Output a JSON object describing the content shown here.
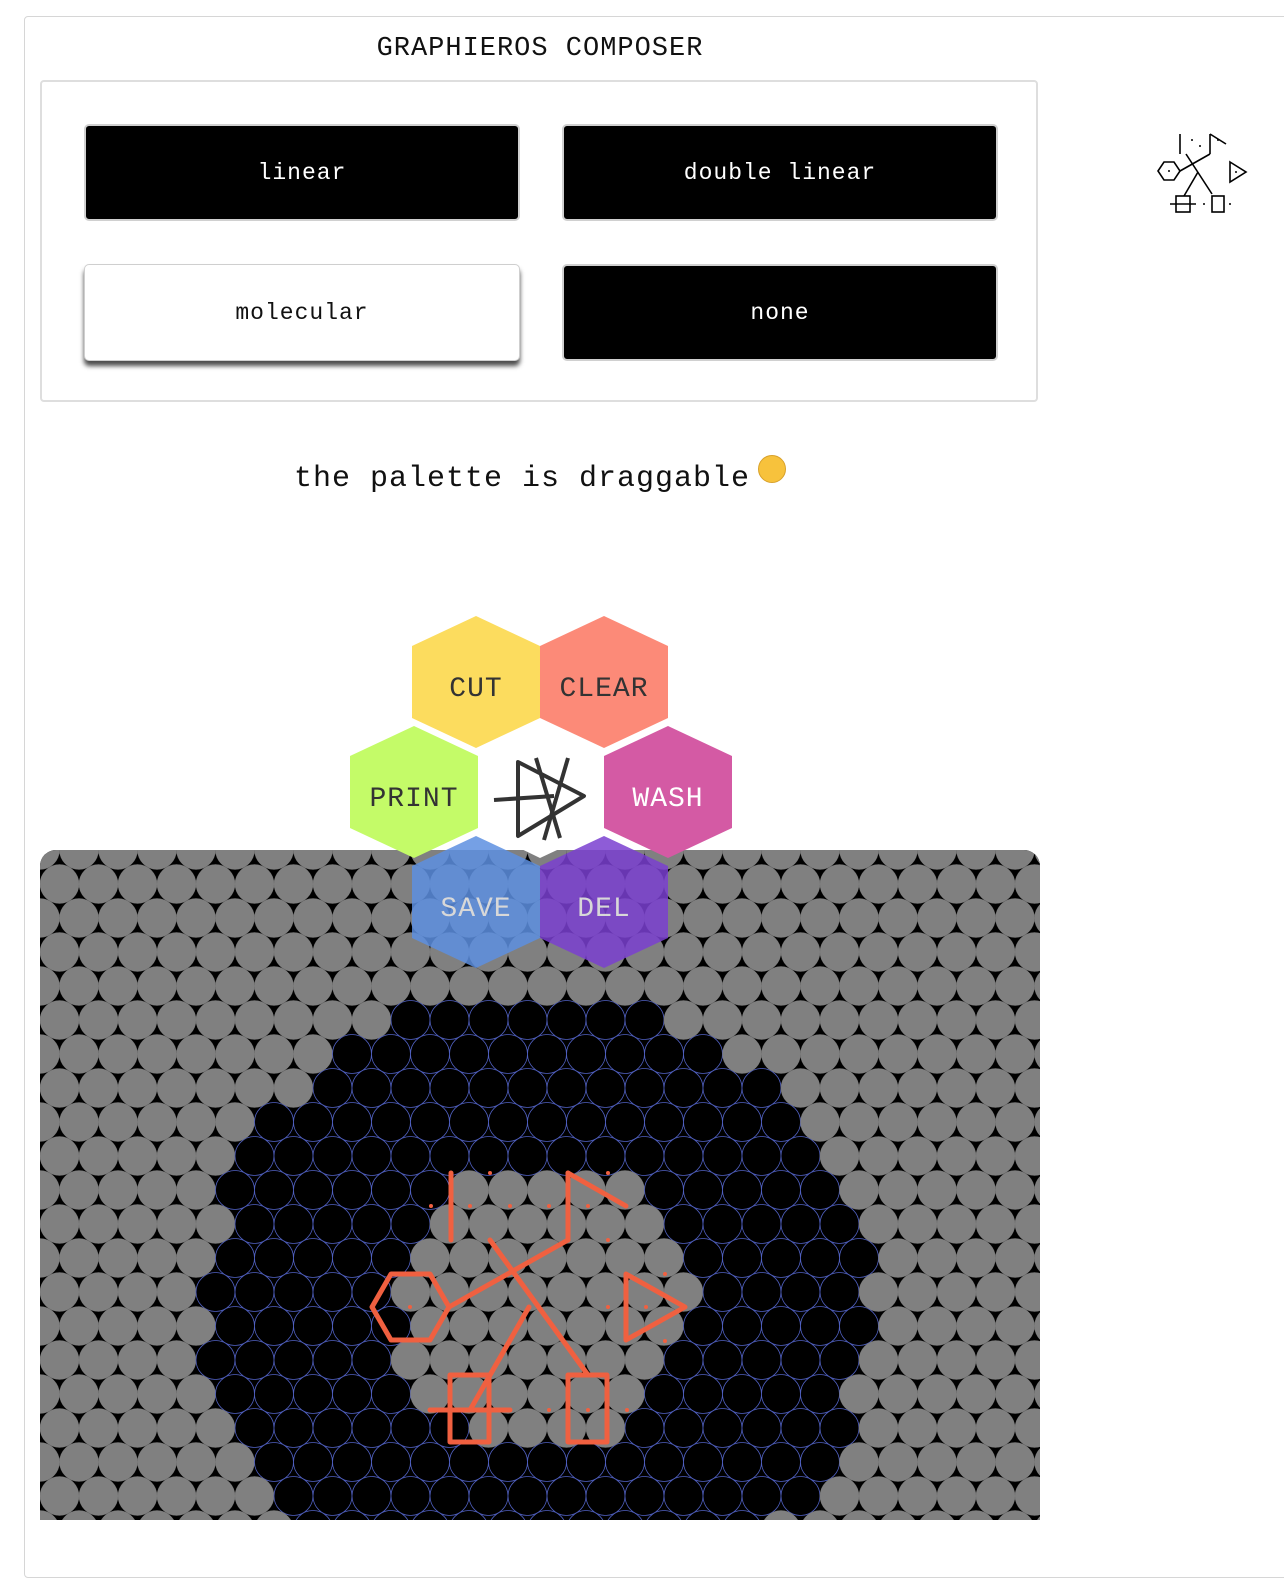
{
  "app": {
    "title": "GRAPHIEROS COMPOSER",
    "hint": "the palette is draggable"
  },
  "modes": {
    "linear": "linear",
    "double_linear": "double linear",
    "molecular": "molecular",
    "none": "none",
    "selected": "molecular"
  },
  "palette": {
    "cut": "CUT",
    "clear": "CLEAR",
    "print": "PRINT",
    "wash": "WASH",
    "save": "SAVE",
    "del": "DEL",
    "colors": {
      "cut": "#fcdc5e",
      "clear": "#fc8a78",
      "print": "#c4fb68",
      "wash": "#d45aa4",
      "save": "#5d8fe0",
      "del": "#7a3fd0",
      "center": "#ffffff"
    },
    "center_icon": "graphieros-logo-icon"
  },
  "canvas": {
    "grid_colors": {
      "filled": "#808080",
      "empty": "#000000",
      "cell_outline": "#5060c0",
      "glyph_stroke": "#f06040"
    }
  }
}
